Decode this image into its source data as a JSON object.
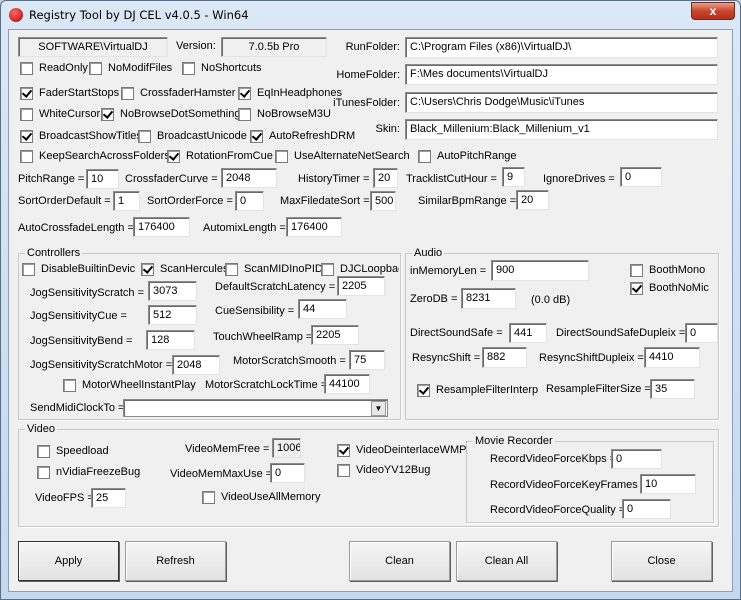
{
  "window": {
    "title": "Registry Tool by DJ CEL v4.0.5 - Win64",
    "close": "x"
  },
  "top": {
    "regkey": "SOFTWARE\\VirtualDJ",
    "version_label": "Version:",
    "version": "7.0.5b Pro"
  },
  "checks": {
    "ReadOnly": {
      "label": "ReadOnly",
      "checked": false
    },
    "NoModifFiles": {
      "label": "NoModifFiles",
      "checked": false
    },
    "NoShortcuts": {
      "label": "NoShortcuts",
      "checked": false
    },
    "FaderStartStops": {
      "label": "FaderStartStops",
      "checked": true
    },
    "CrossfaderHamster": {
      "label": "CrossfaderHamster",
      "checked": false
    },
    "EqInHeadphones": {
      "label": "EqInHeadphones",
      "checked": true
    },
    "WhiteCursor": {
      "label": "WhiteCursor",
      "checked": false
    },
    "NoBrowseDotSomething": {
      "label": "NoBrowseDotSomething",
      "checked": true
    },
    "NoBrowseM3U": {
      "label": "NoBrowseM3U",
      "checked": false
    },
    "BroadcastShowTitles": {
      "label": "BroadcastShowTitles",
      "checked": true
    },
    "BroadcastUnicode": {
      "label": "BroadcastUnicode",
      "checked": false
    },
    "AutoRefreshDRM": {
      "label": "AutoRefreshDRM",
      "checked": true
    },
    "KeepSearchAcrossFolders": {
      "label": "KeepSearchAcrossFolders",
      "checked": false
    },
    "RotationFromCue": {
      "label": "RotationFromCue",
      "checked": true
    },
    "UseAlternateNetSearch": {
      "label": "UseAlternateNetSearch",
      "checked": false
    },
    "AutoPitchRange": {
      "label": "AutoPitchRange",
      "checked": false
    }
  },
  "folders": {
    "run_label": "RunFolder:",
    "run": "C:\\Program Files (x86)\\VirtualDJ\\",
    "home_label": "HomeFolder:",
    "home": "F:\\Mes documents\\VirtualDJ",
    "itunes_label": "iTunesFolder:",
    "itunes": "C:\\Users\\Chris Dodge\\Music\\iTunes",
    "skin_label": "Skin:",
    "skin": "Black_Millenium:Black_Millenium_v1"
  },
  "fields": {
    "PitchRange": {
      "label": "PitchRange =",
      "value": "10"
    },
    "CrossfaderCurve": {
      "label": "CrossfaderCurve =",
      "value": "2048"
    },
    "HistoryTimer": {
      "label": "HistoryTimer =",
      "value": "20"
    },
    "TracklistCutHour": {
      "label": "TracklistCutHour =",
      "value": "9"
    },
    "IgnoreDrives": {
      "label": "IgnoreDrives =",
      "value": "0"
    },
    "SortOrderDefault": {
      "label": "SortOrderDefault =",
      "value": "1"
    },
    "SortOrderForce": {
      "label": "SortOrderForce =",
      "value": "0"
    },
    "MaxFiledateSort": {
      "label": "MaxFiledateSort =",
      "value": "500"
    },
    "SimilarBpmRange": {
      "label": "SimilarBpmRange =",
      "value": "20"
    },
    "AutoCrossfadeLength": {
      "label": "AutoCrossfadeLength =",
      "value": "176400"
    },
    "AutomixLength": {
      "label": "AutomixLength =",
      "value": "176400"
    }
  },
  "controllers": {
    "title": "Controllers",
    "checks": {
      "DisableBuiltinDevices": {
        "label": "DisableBuiltinDevices",
        "checked": false
      },
      "ScanHercules": {
        "label": "ScanHercules",
        "checked": true
      },
      "ScanMIDInoPID": {
        "label": "ScanMIDInoPID",
        "checked": false
      },
      "DJCLoopback": {
        "label": "DJCLoopback",
        "checked": false
      },
      "MotorWheelInstantPlay": {
        "label": "MotorWheelInstantPlay",
        "checked": false
      }
    },
    "fields": {
      "JogSensitivityScratch": {
        "label": "JogSensitivityScratch =",
        "value": "3073"
      },
      "DefaultScratchLatency": {
        "label": "DefaultScratchLatency =",
        "value": "2205"
      },
      "JogSensitivityCue": {
        "label": "JogSensitivityCue =",
        "value": "512"
      },
      "CueSensibility": {
        "label": "CueSensibility =",
        "value": "44"
      },
      "JogSensitivityBend": {
        "label": "JogSensitivityBend =",
        "value": "128"
      },
      "TouchWheelRamp": {
        "label": "TouchWheelRamp =",
        "value": "2205"
      },
      "JogSensitivityScratchMotor": {
        "label": "JogSensitivityScratchMotor =",
        "value": "2048"
      },
      "MotorScratchSmooth": {
        "label": "MotorScratchSmooth =",
        "value": "75"
      },
      "MotorScratchLockTime": {
        "label": "MotorScratchLockTime =",
        "value": "44100"
      },
      "SendMidiClockTo": {
        "label": "SendMidiClockTo =",
        "value": ""
      }
    }
  },
  "audio": {
    "title": "Audio",
    "zerodb_note": "(0.0 dB)",
    "checks": {
      "BoothMono": {
        "label": "BoothMono",
        "checked": false
      },
      "BoothNoMic": {
        "label": "BoothNoMic",
        "checked": true
      },
      "ResampleFilterInterp": {
        "label": "ResampleFilterInterp",
        "checked": true
      }
    },
    "fields": {
      "inMemoryLen": {
        "label": "inMemoryLen =",
        "value": "900"
      },
      "ZeroDB": {
        "label": "ZeroDB =",
        "value": "8231"
      },
      "DirectSoundSafe": {
        "label": "DirectSoundSafe =",
        "value": "441"
      },
      "DirectSoundSafeDupleix": {
        "label": "DirectSoundSafeDupleix =",
        "value": "0"
      },
      "ResyncShift": {
        "label": "ResyncShift =",
        "value": "882"
      },
      "ResyncShiftDupleix": {
        "label": "ResyncShiftDupleix =",
        "value": "4410"
      },
      "ResampleFilterSize": {
        "label": "ResampleFilterSize =",
        "value": "35"
      }
    }
  },
  "video": {
    "title": "Video",
    "checks": {
      "Speedload": {
        "label": "Speedload",
        "checked": false
      },
      "nVidiaFreezeBug": {
        "label": "nVidiaFreezeBug",
        "checked": false
      },
      "VideoUseAllMemory": {
        "label": "VideoUseAllMemory",
        "checked": false
      },
      "VideoDeinterlaceWMP": {
        "label": "VideoDeinterlaceWMP",
        "checked": true
      },
      "VideoYV12Bug": {
        "label": "VideoYV12Bug",
        "checked": false
      }
    },
    "fields": {
      "VideoFPS": {
        "label": "VideoFPS =",
        "value": "25"
      },
      "VideoMemFree": {
        "label": "VideoMemFree =",
        "value": "1006"
      },
      "VideoMemMaxUse": {
        "label": "VideoMemMaxUse =",
        "value": "0"
      }
    },
    "recorder": {
      "title": "Movie Recorder",
      "RecordVideoForceKbps": {
        "label": "RecordVideoForceKbps =",
        "value": "0"
      },
      "RecordVideoForceKeyFrames": {
        "label": "RecordVideoForceKeyFrames =",
        "value": "10"
      },
      "RecordVideoForceQuality": {
        "label": "RecordVideoForceQuality =",
        "value": "0"
      }
    }
  },
  "buttons": {
    "apply": "Apply",
    "refresh": "Refresh",
    "clean": "Clean",
    "clean_all": "Clean All",
    "close": "Close"
  }
}
